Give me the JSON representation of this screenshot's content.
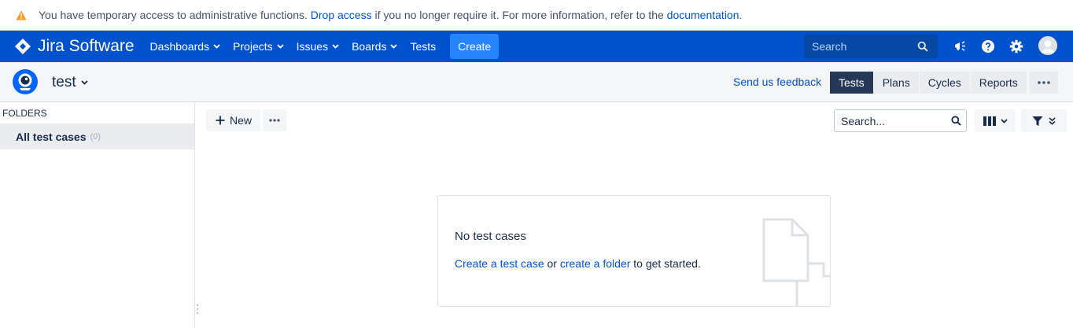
{
  "banner": {
    "icon": "warning-icon",
    "text_before": "You have temporary access to administrative functions. ",
    "link_drop": "Drop access",
    "text_middle": " if you no longer require it. For more information, refer to the ",
    "link_docs": "documentation",
    "text_after": ".",
    "color": "#ff991f"
  },
  "topnav": {
    "brand": "Jira Software",
    "items": [
      {
        "label": "Dashboards",
        "dropdown": true
      },
      {
        "label": "Projects",
        "dropdown": true
      },
      {
        "label": "Issues",
        "dropdown": true
      },
      {
        "label": "Boards",
        "dropdown": true
      },
      {
        "label": "Tests",
        "dropdown": false
      }
    ],
    "create_label": "Create",
    "search_placeholder": "Search",
    "icons": [
      "search-icon",
      "notifications-megaphone-icon",
      "help-icon",
      "settings-gear-icon",
      "user-avatar"
    ],
    "background": "#0052cc"
  },
  "project": {
    "name": "test",
    "feedback_link": "Send us feedback",
    "tabs": [
      {
        "label": "Tests",
        "active": true
      },
      {
        "label": "Plans",
        "active": false
      },
      {
        "label": "Cycles",
        "active": false
      },
      {
        "label": "Reports",
        "active": false
      }
    ]
  },
  "sidebar": {
    "folders_label": "FOLDERS",
    "items": [
      {
        "label": "All test cases",
        "count": "(0)"
      }
    ]
  },
  "toolbar": {
    "new_label": "New",
    "search_placeholder": "Search...",
    "icons": [
      "plus-icon",
      "more-horizontal-icon",
      "search-icon",
      "columns-icon",
      "filter-icon"
    ]
  },
  "empty_state": {
    "title": "No test cases",
    "create_test_case_link": "Create a test case",
    "or_text": " or ",
    "create_folder_link": "create a folder",
    "suffix_text": " to get started.",
    "icon": "document-illustration-icon"
  }
}
